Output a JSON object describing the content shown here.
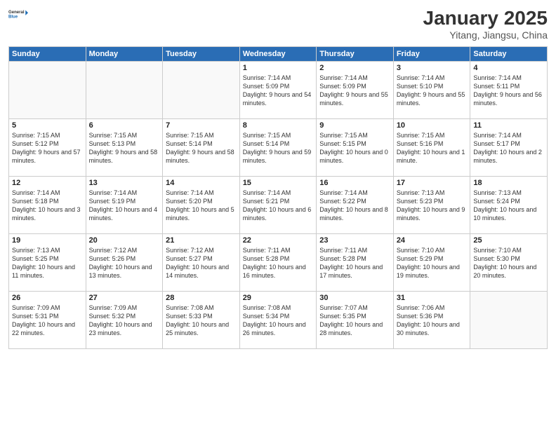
{
  "header": {
    "logo_line1": "General",
    "logo_line2": "Blue",
    "month": "January 2025",
    "location": "Yitang, Jiangsu, China"
  },
  "days_of_week": [
    "Sunday",
    "Monday",
    "Tuesday",
    "Wednesday",
    "Thursday",
    "Friday",
    "Saturday"
  ],
  "weeks": [
    [
      {
        "day": "",
        "empty": true
      },
      {
        "day": "",
        "empty": true
      },
      {
        "day": "",
        "empty": true
      },
      {
        "day": "1",
        "sunrise": "7:14 AM",
        "sunset": "5:09 PM",
        "daylight": "9 hours and 54 minutes."
      },
      {
        "day": "2",
        "sunrise": "7:14 AM",
        "sunset": "5:09 PM",
        "daylight": "9 hours and 55 minutes."
      },
      {
        "day": "3",
        "sunrise": "7:14 AM",
        "sunset": "5:10 PM",
        "daylight": "9 hours and 55 minutes."
      },
      {
        "day": "4",
        "sunrise": "7:14 AM",
        "sunset": "5:11 PM",
        "daylight": "9 hours and 56 minutes."
      }
    ],
    [
      {
        "day": "5",
        "sunrise": "7:15 AM",
        "sunset": "5:12 PM",
        "daylight": "9 hours and 57 minutes."
      },
      {
        "day": "6",
        "sunrise": "7:15 AM",
        "sunset": "5:13 PM",
        "daylight": "9 hours and 58 minutes."
      },
      {
        "day": "7",
        "sunrise": "7:15 AM",
        "sunset": "5:14 PM",
        "daylight": "9 hours and 58 minutes."
      },
      {
        "day": "8",
        "sunrise": "7:15 AM",
        "sunset": "5:14 PM",
        "daylight": "9 hours and 59 minutes."
      },
      {
        "day": "9",
        "sunrise": "7:15 AM",
        "sunset": "5:15 PM",
        "daylight": "10 hours and 0 minutes."
      },
      {
        "day": "10",
        "sunrise": "7:15 AM",
        "sunset": "5:16 PM",
        "daylight": "10 hours and 1 minute."
      },
      {
        "day": "11",
        "sunrise": "7:14 AM",
        "sunset": "5:17 PM",
        "daylight": "10 hours and 2 minutes."
      }
    ],
    [
      {
        "day": "12",
        "sunrise": "7:14 AM",
        "sunset": "5:18 PM",
        "daylight": "10 hours and 3 minutes."
      },
      {
        "day": "13",
        "sunrise": "7:14 AM",
        "sunset": "5:19 PM",
        "daylight": "10 hours and 4 minutes."
      },
      {
        "day": "14",
        "sunrise": "7:14 AM",
        "sunset": "5:20 PM",
        "daylight": "10 hours and 5 minutes."
      },
      {
        "day": "15",
        "sunrise": "7:14 AM",
        "sunset": "5:21 PM",
        "daylight": "10 hours and 6 minutes."
      },
      {
        "day": "16",
        "sunrise": "7:14 AM",
        "sunset": "5:22 PM",
        "daylight": "10 hours and 8 minutes."
      },
      {
        "day": "17",
        "sunrise": "7:13 AM",
        "sunset": "5:23 PM",
        "daylight": "10 hours and 9 minutes."
      },
      {
        "day": "18",
        "sunrise": "7:13 AM",
        "sunset": "5:24 PM",
        "daylight": "10 hours and 10 minutes."
      }
    ],
    [
      {
        "day": "19",
        "sunrise": "7:13 AM",
        "sunset": "5:25 PM",
        "daylight": "10 hours and 11 minutes."
      },
      {
        "day": "20",
        "sunrise": "7:12 AM",
        "sunset": "5:26 PM",
        "daylight": "10 hours and 13 minutes."
      },
      {
        "day": "21",
        "sunrise": "7:12 AM",
        "sunset": "5:27 PM",
        "daylight": "10 hours and 14 minutes."
      },
      {
        "day": "22",
        "sunrise": "7:11 AM",
        "sunset": "5:28 PM",
        "daylight": "10 hours and 16 minutes."
      },
      {
        "day": "23",
        "sunrise": "7:11 AM",
        "sunset": "5:28 PM",
        "daylight": "10 hours and 17 minutes."
      },
      {
        "day": "24",
        "sunrise": "7:10 AM",
        "sunset": "5:29 PM",
        "daylight": "10 hours and 19 minutes."
      },
      {
        "day": "25",
        "sunrise": "7:10 AM",
        "sunset": "5:30 PM",
        "daylight": "10 hours and 20 minutes."
      }
    ],
    [
      {
        "day": "26",
        "sunrise": "7:09 AM",
        "sunset": "5:31 PM",
        "daylight": "10 hours and 22 minutes."
      },
      {
        "day": "27",
        "sunrise": "7:09 AM",
        "sunset": "5:32 PM",
        "daylight": "10 hours and 23 minutes."
      },
      {
        "day": "28",
        "sunrise": "7:08 AM",
        "sunset": "5:33 PM",
        "daylight": "10 hours and 25 minutes."
      },
      {
        "day": "29",
        "sunrise": "7:08 AM",
        "sunset": "5:34 PM",
        "daylight": "10 hours and 26 minutes."
      },
      {
        "day": "30",
        "sunrise": "7:07 AM",
        "sunset": "5:35 PM",
        "daylight": "10 hours and 28 minutes."
      },
      {
        "day": "31",
        "sunrise": "7:06 AM",
        "sunset": "5:36 PM",
        "daylight": "10 hours and 30 minutes."
      },
      {
        "day": "",
        "empty": true
      }
    ]
  ]
}
